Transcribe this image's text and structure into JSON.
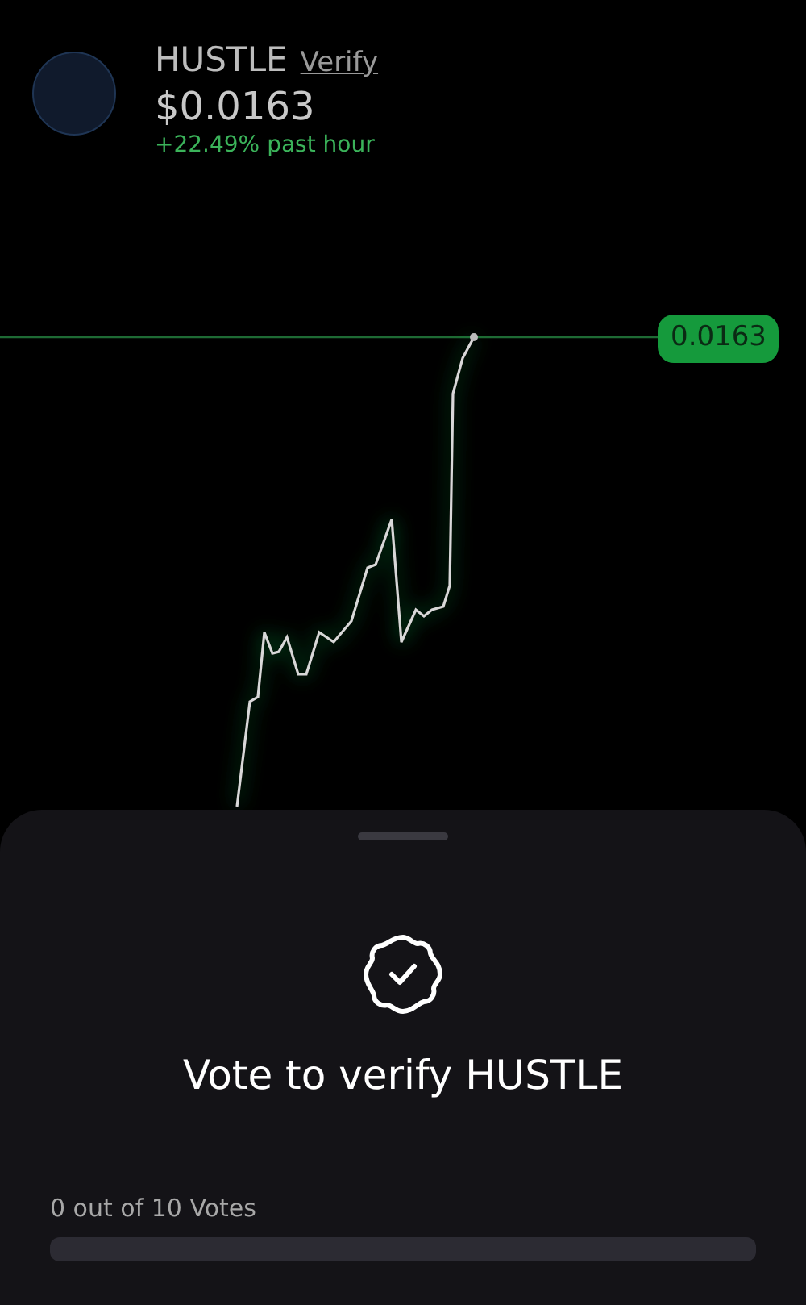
{
  "token": {
    "symbol": "HUSTLE",
    "verify_link": "Verify",
    "price": "$0.0163",
    "change": "+22.49% past hour"
  },
  "chart": {
    "price_tag": "0.0163"
  },
  "sheet": {
    "title": "Vote to verify HUSTLE",
    "votes_label": "0 out of 10 Votes",
    "level": 0
  }
}
